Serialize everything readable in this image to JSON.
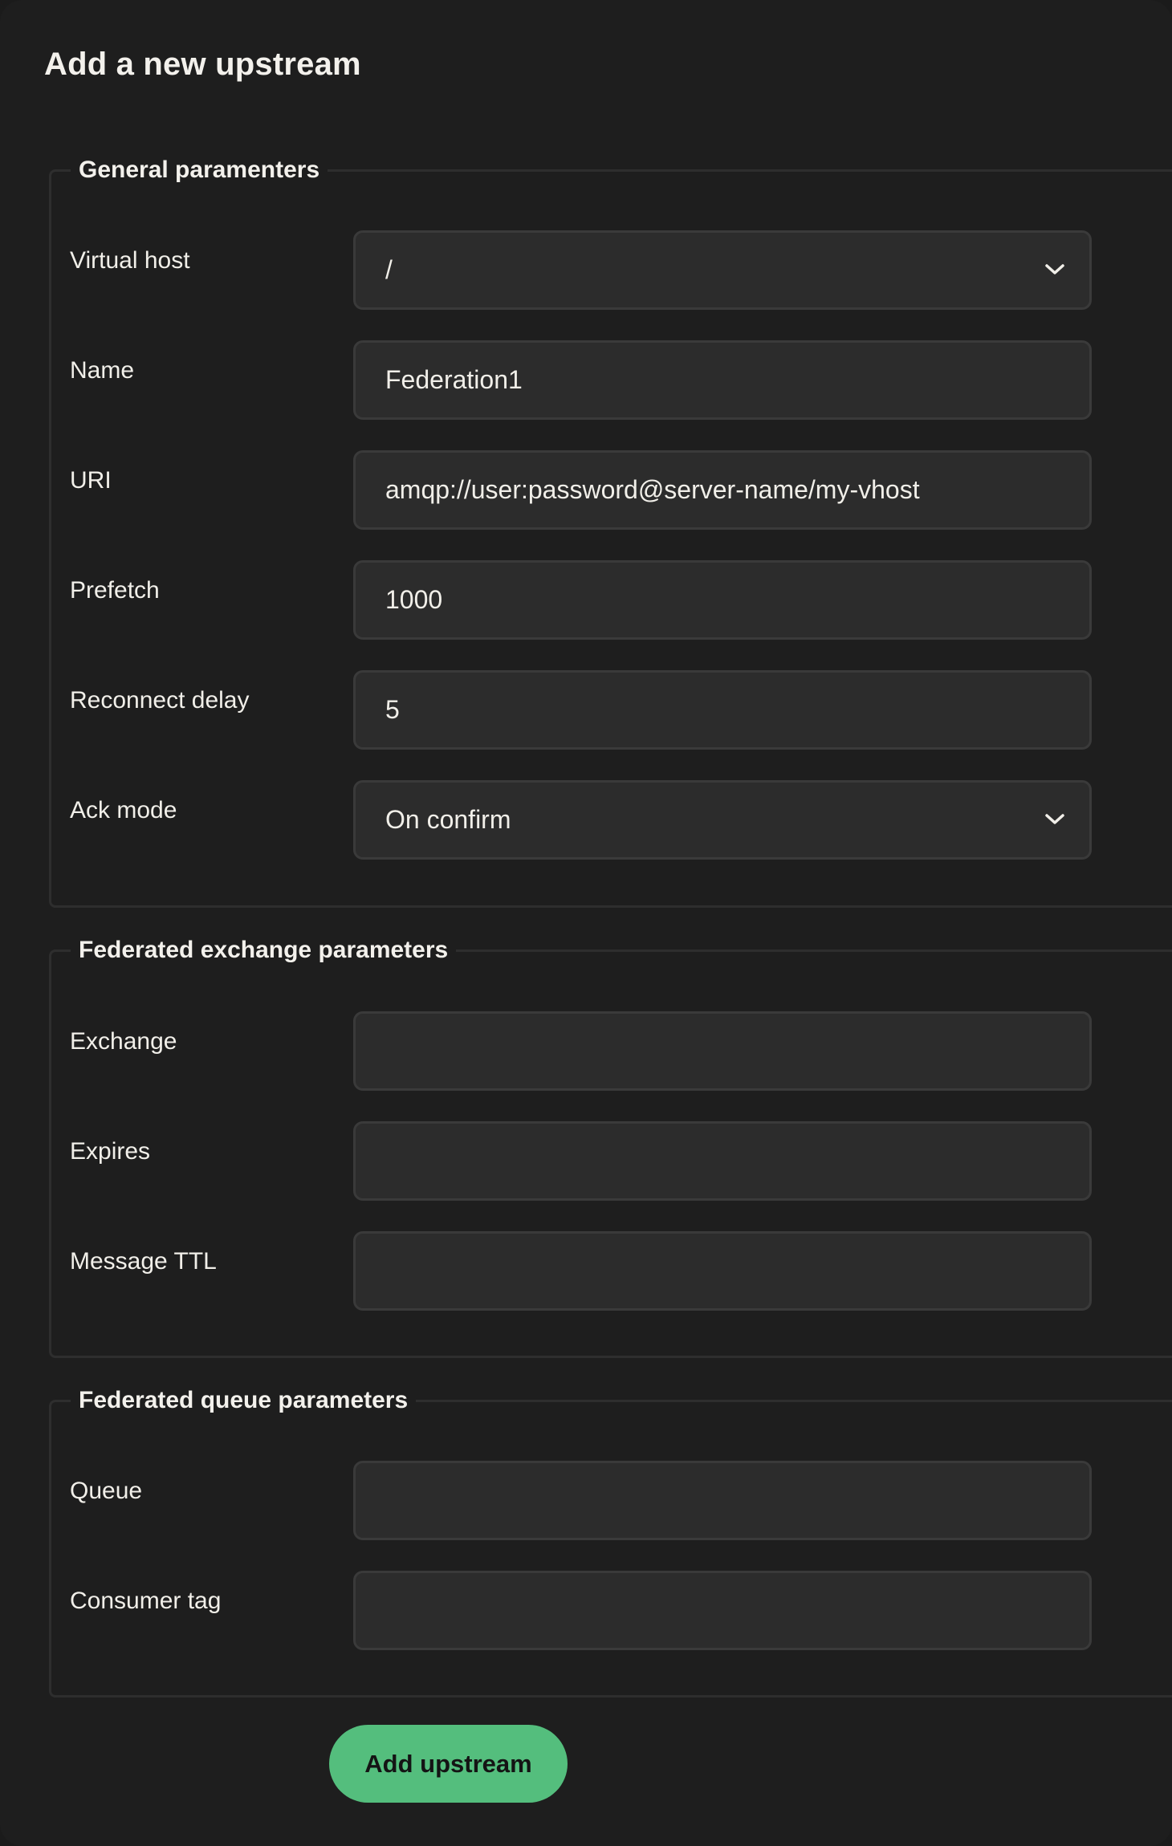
{
  "page": {
    "title": "Add a new upstream"
  },
  "general": {
    "legend": "General paramenters",
    "virtual_host": {
      "label": "Virtual host",
      "value": "/"
    },
    "name": {
      "label": "Name",
      "value": "Federation1"
    },
    "uri": {
      "label": "URI",
      "value": "amqp://user:password@server-name/my-vhost"
    },
    "prefetch": {
      "label": "Prefetch",
      "value": "1000"
    },
    "reconnect_delay": {
      "label": "Reconnect delay",
      "value": "5"
    },
    "ack_mode": {
      "label": "Ack mode",
      "value": "On confirm"
    }
  },
  "exchange": {
    "legend": "Federated exchange parameters",
    "exchange": {
      "label": "Exchange",
      "value": ""
    },
    "expires": {
      "label": "Expires",
      "value": ""
    },
    "message_ttl": {
      "label": "Message TTL",
      "value": ""
    }
  },
  "queue": {
    "legend": "Federated queue parameters",
    "queue": {
      "label": "Queue",
      "value": ""
    },
    "consumer_tag": {
      "label": "Consumer tag",
      "value": ""
    }
  },
  "actions": {
    "submit_label": "Add upstream"
  },
  "icons": {
    "select_arrow": "chevron-down-icon"
  },
  "colors": {
    "background": "#1e1e1e",
    "field": "#2c2c2c",
    "accent": "#54be7d"
  }
}
